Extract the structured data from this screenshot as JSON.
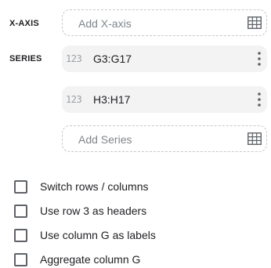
{
  "xaxis": {
    "label": "X-AXIS",
    "placeholder": "Add X-axis",
    "icon": "grid-icon"
  },
  "series": {
    "label": "SERIES",
    "items": [
      {
        "type_glyph": "123",
        "range": "G3:G17",
        "icon": "more-vert-icon"
      },
      {
        "type_glyph": "123",
        "range": "H3:H17",
        "icon": "more-vert-icon"
      }
    ],
    "add_placeholder": "Add Series",
    "add_icon": "grid-icon"
  },
  "options": [
    {
      "label": "Switch rows / columns",
      "checked": false
    },
    {
      "label": "Use row 3 as headers",
      "checked": false
    },
    {
      "label": "Use column G as labels",
      "checked": false
    },
    {
      "label": "Aggregate column G",
      "checked": false
    }
  ],
  "colors": {
    "text": "#202124",
    "muted": "#80868b",
    "field_bg": "#f3f3f3",
    "dashed_border": "#c8c8c8"
  }
}
